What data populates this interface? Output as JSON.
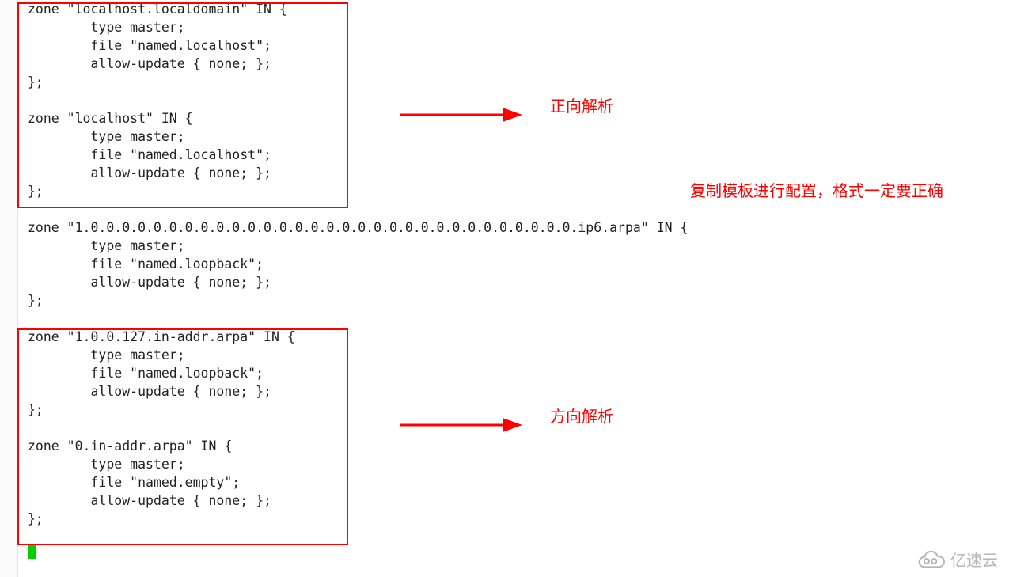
{
  "code_text": "zone \"localhost.localdomain\" IN {\n        type master;\n        file \"named.localhost\";\n        allow-update { none; };\n};\n\nzone \"localhost\" IN {\n        type master;\n        file \"named.localhost\";\n        allow-update { none; };\n};\n\nzone \"1.0.0.0.0.0.0.0.0.0.0.0.0.0.0.0.0.0.0.0.0.0.0.0.0.0.0.0.0.0.0.0.ip6.arpa\" IN {\n        type master;\n        file \"named.loopback\";\n        allow-update { none; };\n};\n\nzone \"1.0.0.127.in-addr.arpa\" IN {\n        type master;\n        file \"named.loopback\";\n        allow-update { none; };\n};\n\nzone \"0.in-addr.arpa\" IN {\n        type master;\n        file \"named.empty\";\n        allow-update { none; };\n};",
  "annotations": {
    "forward": "正向解析",
    "template_note": "复制模板进行配置，格式一定要正确",
    "reverse": "方向解析"
  },
  "watermark": "亿速云"
}
